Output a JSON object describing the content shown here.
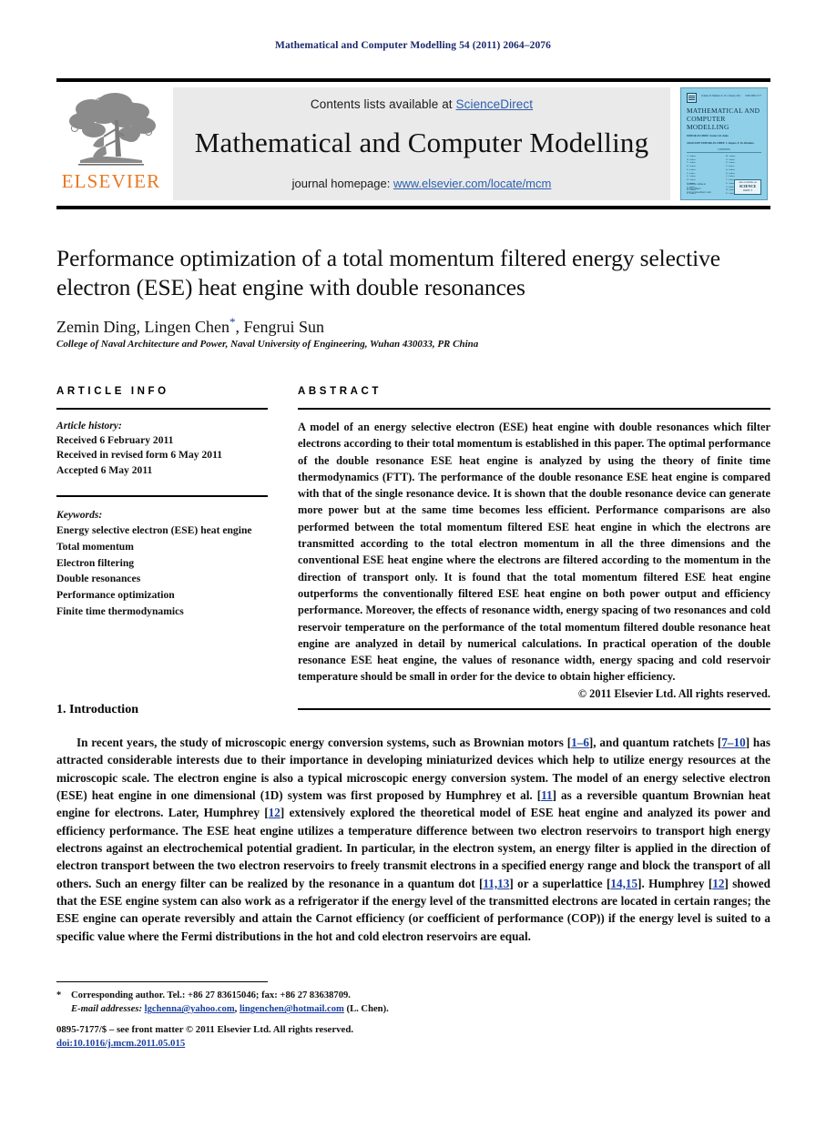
{
  "running_head": "Mathematical and Computer Modelling 54 (2011) 2064–2076",
  "masthead": {
    "contents_prefix": "Contents lists available at ",
    "sciencedirect": "ScienceDirect",
    "journal_title": "Mathematical and Computer Modelling",
    "homepage_prefix": "journal homepage: ",
    "homepage_url": "www.elsevier.com/locate/mcm",
    "publisher": "ELSEVIER",
    "publisher_color": "#E87722",
    "link_color": "#2b5fb0"
  },
  "cover": {
    "top_center": "Volume 54 Numbers 9–10  1 January 2011",
    "top_right": "ISSN 0895-7177",
    "title": "MATHEMATICAL AND COMPUTER MODELLING",
    "editors_line1": "EDITOR-IN-CHIEF: Xavier J.R. Avula",
    "editors_line2": "ASSOCIATE EDITORS-IN-CHIEF: C. Rogers, E. Yu. Khruslov",
    "contents_label": "CONTENTS",
    "toc_left": "A. Author\nB. Author\nC. Author\nD. Author\nE. Author\nF. Author\nG. Author\nH. Author\nI. Author\nJ. Author\nK. Author\nL. Author",
    "toc_right": "M. Author\nN. Author\nO. Author\nP. Author\nQ. Author\nR. Author\nS. Author\nT. Author\nU. Author\nV. Author\nW. Author\nX. Author",
    "sciencedirect_line1": "Available online at",
    "sciencedirect_line2": "ScienceDirect",
    "sciencedirect_line3": "www.sciencedirect.com",
    "badge_line1": "Also available on",
    "badge_main": "SCIENCE",
    "badge_line3": "DIRECT",
    "bg_color": "#8fcfe8"
  },
  "paper": {
    "title": "Performance optimization of a total momentum filtered energy selective electron (ESE) heat engine with double resonances",
    "authors": "Zemin Ding, Lingen Chen",
    "authors_suffix": ", Fengrui Sun",
    "corresponding_marker": "*",
    "affiliation": "College of Naval Architecture and Power, Naval University of Engineering, Wuhan 430033, PR China"
  },
  "article_info": {
    "label": "ARTICLE INFO",
    "history_label": "Article history:",
    "history": [
      "Received 6 February 2011",
      "Received in revised form 6 May 2011",
      "Accepted 6 May 2011"
    ],
    "keywords_label": "Keywords:",
    "keywords": [
      "Energy selective electron (ESE) heat engine",
      "Total momentum",
      "Electron filtering",
      "Double resonances",
      "Performance optimization",
      "Finite time thermodynamics"
    ]
  },
  "abstract": {
    "label": "ABSTRACT",
    "text": "A model of an energy selective electron (ESE) heat engine with double resonances which filter electrons according to their total momentum is established in this paper. The optimal performance of the double resonance ESE heat engine is analyzed by using the theory of finite time thermodynamics (FTT). The performance of the double resonance ESE heat engine is compared with that of the single resonance device. It is shown that the double resonance device can generate more power but at the same time becomes less efficient. Performance comparisons are also performed between the total momentum filtered ESE heat engine in which the electrons are transmitted according to the total electron momentum in all the three dimensions and the conventional ESE heat engine where the electrons are filtered according to the momentum in the direction of transport only. It is found that the total momentum filtered ESE heat engine outperforms the conventionally filtered ESE heat engine on both power output and efficiency performance. Moreover, the effects of resonance width, energy spacing of two resonances and cold reservoir temperature on the performance of the total momentum filtered double resonance heat engine are analyzed in detail by numerical calculations. In practical operation of the double resonance ESE heat engine, the values of resonance width, energy spacing and cold reservoir temperature should be small in order for the device to obtain higher efficiency.",
    "copyright": "© 2011 Elsevier Ltd. All rights reserved."
  },
  "introduction": {
    "heading": "1. Introduction",
    "paragraph_parts": [
      "In recent years, the study of microscopic energy conversion systems, such as Brownian motors [",
      "1–6",
      "], and quantum ratchets [",
      "7–10",
      "] has attracted considerable interests due to their importance in developing miniaturized devices which help to utilize energy resources at the microscopic scale. The electron engine is also a typical microscopic energy conversion system. The model of an energy selective electron (ESE) heat engine in one dimensional (1D) system was first proposed by Humphrey et al. [",
      "11",
      "] as a reversible quantum Brownian heat engine for electrons. Later, Humphrey [",
      "12",
      "] extensively explored the theoretical model of ESE heat engine and analyzed its power and efficiency performance. The ESE heat engine utilizes a temperature difference between two electron reservoirs to transport high energy electrons against an electrochemical potential gradient. In particular, in the electron system, an energy filter is applied in the direction of electron transport between the two electron reservoirs to freely transmit electrons in a specified energy range and block the transport of all others. Such an energy filter can be realized by the resonance in a quantum dot [",
      "11,13",
      "] or a superlattice [",
      "14,15",
      "]. Humphrey [",
      "12",
      "] showed that the ESE engine system can also work as a refrigerator if the energy level of the transmitted electrons are located in certain ranges; the ESE engine can operate reversibly and attain the Carnot efficiency (or coefficient of performance (COP)) if the energy level is suited to a specific value where the Fermi distributions in the hot and cold electron reservoirs are equal."
    ]
  },
  "footnote": {
    "marker": "*",
    "corresponding": "Corresponding author. Tel.: +86 27 83615046; fax: +86 27 83638709.",
    "email_label": "E-mail addresses:",
    "email1": "lgchenna@yahoo.com",
    "email_sep": ", ",
    "email2": "lingenchen@hotmail.com",
    "email_suffix": " (L. Chen)."
  },
  "footer": {
    "issn_line": "0895-7177/$ – see front matter © 2011 Elsevier Ltd. All rights reserved.",
    "doi": "doi:10.1016/j.mcm.2011.05.015"
  }
}
